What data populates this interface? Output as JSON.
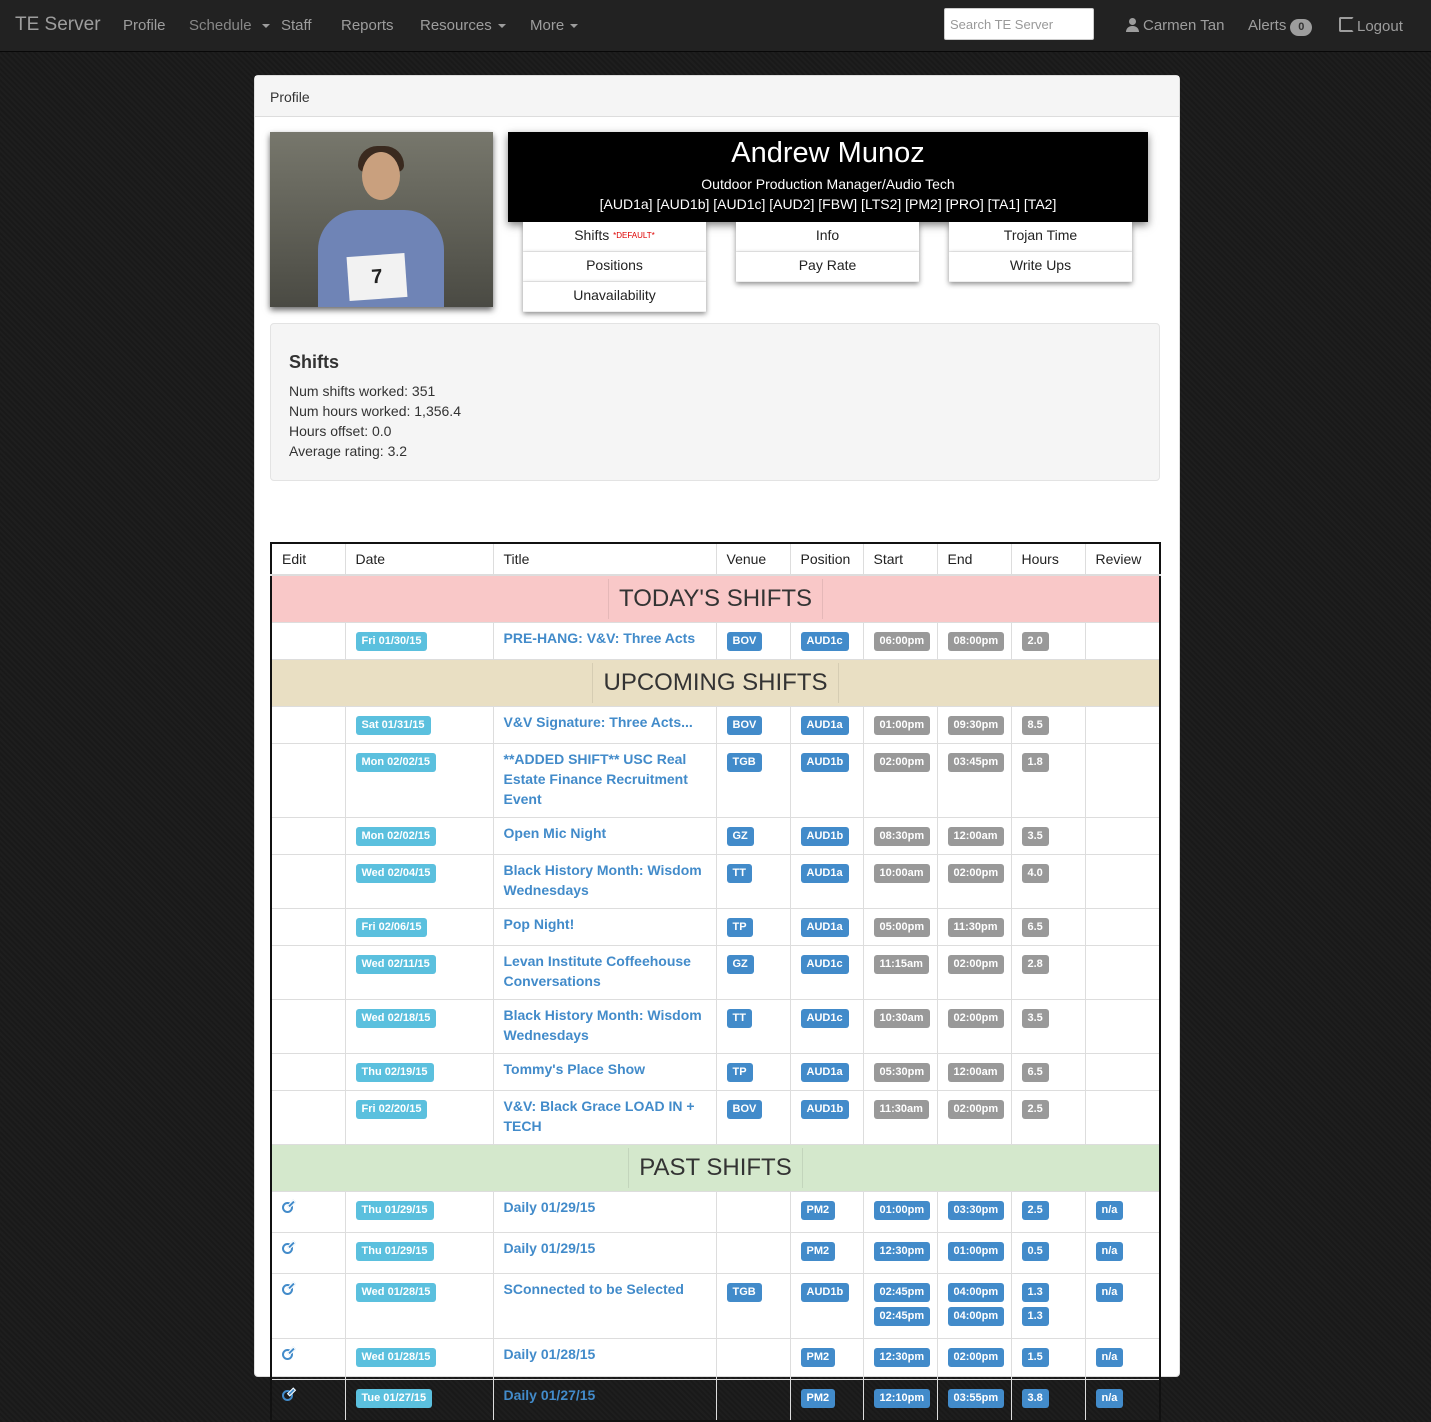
{
  "navbar": {
    "brand": "TE Server",
    "items": [
      "Profile",
      "Schedule",
      "Staff",
      "Reports",
      "Resources",
      "More"
    ],
    "search_placeholder": "Search TE Server",
    "user": "Carmen Tan",
    "alerts_label": "Alerts",
    "alerts_count": "0",
    "logout": "Logout"
  },
  "panel": {
    "heading": "Profile"
  },
  "profile": {
    "photo_number": "7",
    "name": "Andrew Munoz",
    "title": "Outdoor Production Manager/Audio Tech",
    "certs": "[AUD1a] [AUD1b] [AUD1c] [AUD2] [FBW] [LTS2] [PM2] [PRO] [TA1] [TA2]"
  },
  "menu": {
    "shifts": "Shifts",
    "shifts_default": "*DEFAULT*",
    "positions": "Positions",
    "unavailability": "Unavailability",
    "info": "Info",
    "pay_rate": "Pay Rate",
    "trojan_time": "Trojan Time",
    "write_ups": "Write Ups"
  },
  "stats": {
    "heading": "Shifts",
    "shifts_worked": "Num shifts worked: 351",
    "hours_worked": "Num hours worked: 1,356.4",
    "hours_offset": "Hours offset: 0.0",
    "avg_rating": "Average rating: 3.2"
  },
  "table": {
    "headers": [
      "Edit",
      "Date",
      "Title",
      "Venue",
      "Position",
      "Start",
      "End",
      "Hours",
      "Review"
    ],
    "sections": {
      "today": "TODAY'S SHIFTS",
      "upcoming": "UPCOMING SHIFTS",
      "past": "PAST SHIFTS"
    },
    "today": [
      {
        "date": "Fri 01/30/15",
        "title": "PRE-HANG: V&V: Three Acts",
        "venue": "BOV",
        "position": "AUD1c",
        "start": "06:00pm",
        "end": "08:00pm",
        "hours": "2.0"
      }
    ],
    "upcoming": [
      {
        "date": "Sat 01/31/15",
        "title": "V&V Signature: Three Acts...",
        "venue": "BOV",
        "position": "AUD1a",
        "start": "01:00pm",
        "end": "09:30pm",
        "hours": "8.5"
      },
      {
        "date": "Mon 02/02/15",
        "title": "**ADDED SHIFT** USC Real Estate Finance Recruitment Event",
        "venue": "TGB",
        "position": "AUD1b",
        "start": "02:00pm",
        "end": "03:45pm",
        "hours": "1.8"
      },
      {
        "date": "Mon 02/02/15",
        "title": "Open Mic Night",
        "venue": "GZ",
        "position": "AUD1b",
        "start": "08:30pm",
        "end": "12:00am",
        "hours": "3.5"
      },
      {
        "date": "Wed 02/04/15",
        "title": "Black History Month: Wisdom Wednesdays",
        "venue": "TT",
        "position": "AUD1a",
        "start": "10:00am",
        "end": "02:00pm",
        "hours": "4.0"
      },
      {
        "date": "Fri 02/06/15",
        "title": "Pop Night!",
        "venue": "TP",
        "position": "AUD1a",
        "start": "05:00pm",
        "end": "11:30pm",
        "hours": "6.5"
      },
      {
        "date": "Wed 02/11/15",
        "title": "Levan Institute Coffeehouse Conversations",
        "venue": "GZ",
        "position": "AUD1c",
        "start": "11:15am",
        "end": "02:00pm",
        "hours": "2.8"
      },
      {
        "date": "Wed 02/18/15",
        "title": "Black History Month: Wisdom Wednesdays",
        "venue": "TT",
        "position": "AUD1c",
        "start": "10:30am",
        "end": "02:00pm",
        "hours": "3.5"
      },
      {
        "date": "Thu 02/19/15",
        "title": "Tommy's Place Show",
        "venue": "TP",
        "position": "AUD1a",
        "start": "05:30pm",
        "end": "12:00am",
        "hours": "6.5"
      },
      {
        "date": "Fri 02/20/15",
        "title": "V&V: Black Grace LOAD IN + TECH",
        "venue": "BOV",
        "position": "AUD1b",
        "start": "11:30am",
        "end": "02:00pm",
        "hours": "2.5"
      }
    ],
    "past": [
      {
        "date": "Thu 01/29/15",
        "title": "Daily 01/29/15",
        "venue": "",
        "position": "PM2",
        "start": [
          "01:00pm"
        ],
        "end": [
          "03:30pm"
        ],
        "hours": [
          "2.5"
        ],
        "review": "n/a"
      },
      {
        "date": "Thu 01/29/15",
        "title": "Daily 01/29/15",
        "venue": "",
        "position": "PM2",
        "start": [
          "12:30pm"
        ],
        "end": [
          "01:00pm"
        ],
        "hours": [
          "0.5"
        ],
        "review": "n/a"
      },
      {
        "date": "Wed 01/28/15",
        "title": "SConnected to be Selected",
        "venue": "TGB",
        "position": "AUD1b",
        "start": [
          "02:45pm",
          "02:45pm"
        ],
        "end": [
          "04:00pm",
          "04:00pm"
        ],
        "hours": [
          "1.3",
          "1.3"
        ],
        "review": "n/a"
      },
      {
        "date": "Wed 01/28/15",
        "title": "Daily 01/28/15",
        "venue": "",
        "position": "PM2",
        "start": [
          "12:30pm"
        ],
        "end": [
          "02:00pm"
        ],
        "hours": [
          "1.5"
        ],
        "review": "n/a"
      },
      {
        "date": "Tue 01/27/15",
        "title": "Daily 01/27/15",
        "venue": "",
        "position": "PM2",
        "start": [
          "12:10pm"
        ],
        "end": [
          "03:55pm"
        ],
        "hours": [
          "3.8"
        ],
        "review": "n/a"
      }
    ]
  }
}
